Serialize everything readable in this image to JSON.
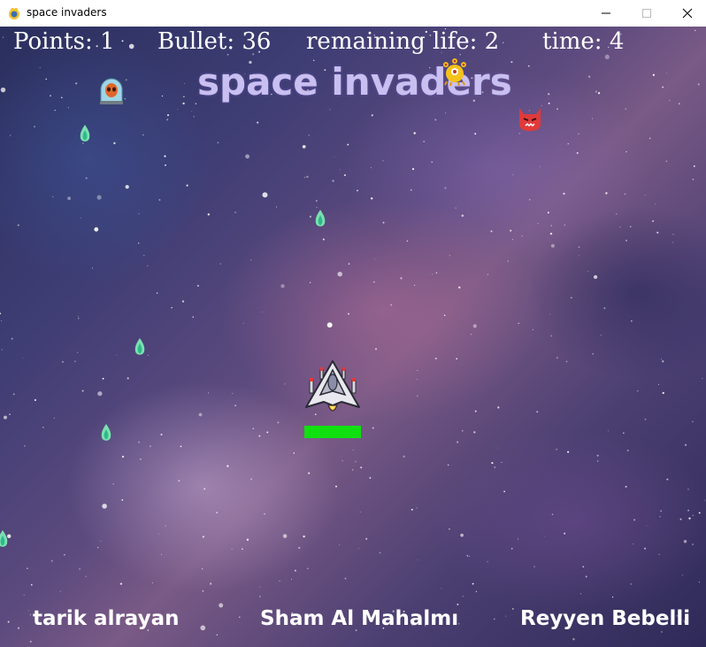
{
  "window": {
    "title": "space invaders",
    "icon": "pygame-snake-icon",
    "controls": [
      "minimize-icon",
      "maximize-icon",
      "close-icon"
    ]
  },
  "hud": {
    "points": "Points: 1",
    "bullet": "Bullet: 36",
    "life": "remaining life: 2",
    "time": "time: 4"
  },
  "game_title": "space invaders",
  "credits": [
    "tarik alrayan",
    "Sham Al Mahalmı",
    "Reyyen Bebelli"
  ],
  "player": {
    "sprite": "spaceship-icon",
    "health": 1.0,
    "health_color": "#10e010"
  },
  "enemies": [
    "alien-pod-icon",
    "yellow-many-eyed-alien-icon",
    "red-devil-alien-icon"
  ],
  "projectiles": [
    "green-flame-bullet-icon"
  ],
  "colors": {
    "title": "#c9bff0",
    "hud_text": "#ffffff",
    "health_bar": "#10e010"
  }
}
